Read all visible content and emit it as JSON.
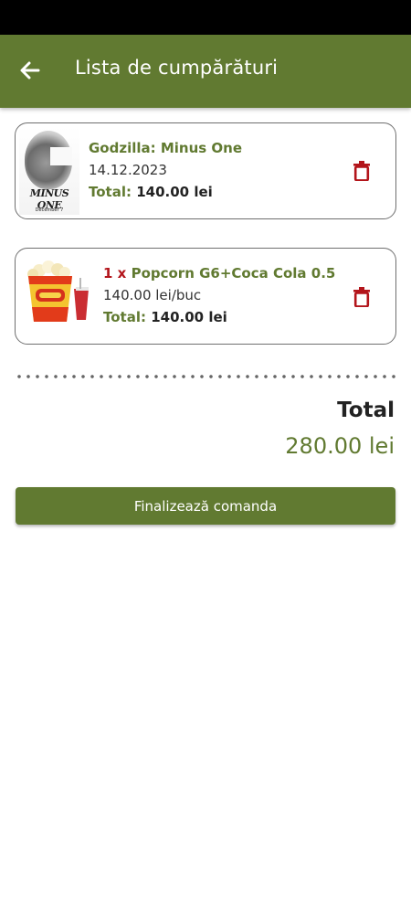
{
  "header": {
    "title": "Lista de cumpărături",
    "back_icon": "arrow-left-icon"
  },
  "cart": {
    "items": [
      {
        "type": "ticket",
        "title": "Godzilla: Minus One",
        "date": "14.12.2023",
        "total_label": "Total:",
        "total_amount": "140.00 lei",
        "poster_title": "MINUS ONE",
        "poster_date": "December 7",
        "delete_icon": "trash-icon"
      },
      {
        "type": "snack",
        "quantity": "1 x",
        "title": "Popcorn G6+Coca Cola 0.5",
        "unit_price": "140.00 lei/buc",
        "total_label": "Total:",
        "total_amount": "140.00 lei",
        "image": "popcorn-cola-image",
        "delete_icon": "trash-icon"
      }
    ]
  },
  "summary": {
    "total_label": "Total",
    "total_value": "280.00 lei"
  },
  "actions": {
    "checkout_label": "Finalizează comanda"
  },
  "colors": {
    "primary": "#617a31",
    "delete": "#b3151b",
    "status_bar": "#000000"
  }
}
